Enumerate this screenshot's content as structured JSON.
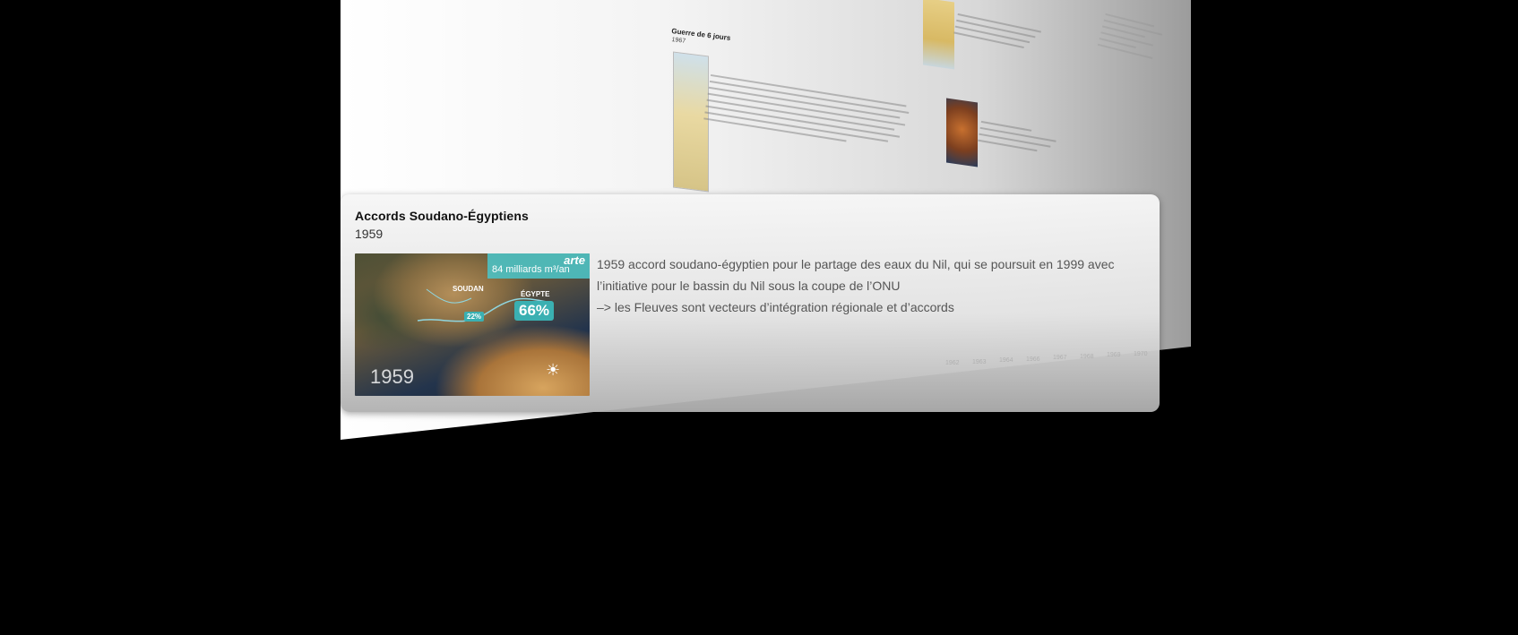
{
  "card": {
    "title": "Accords Soudano-Égyptiens",
    "date": "1959",
    "description_lines": [
      "1959  accord soudano-égyptien pour le partage des eaux du Nil, qui se poursuit en 1999 avec l’initiative pour le bassin du Nil sous la coupe de l’ONU",
      " –> les Fleuves sont vecteurs d’intégration régionale et d’accords"
    ],
    "thumbnail": {
      "logo": "arte",
      "volume": "84 milliards m³/an",
      "label_soudan": "SOUDAN",
      "label_egypte": "ÉGYPTE",
      "share_soudan": "22%",
      "share_egypte": "66%",
      "year": "1959",
      "sun_icon": "sun-icon"
    }
  },
  "background": {
    "event_title": "Guerre de 6 jours",
    "event_year": "1967",
    "timeline_ticks": [
      "1959",
      "1961",
      "1962",
      "1963",
      "1964",
      "1966",
      "1967",
      "1968",
      "1969",
      "1970"
    ]
  },
  "colors": {
    "accent": "#4cc1c3",
    "card_title": "#111111",
    "body_text": "#555555"
  }
}
